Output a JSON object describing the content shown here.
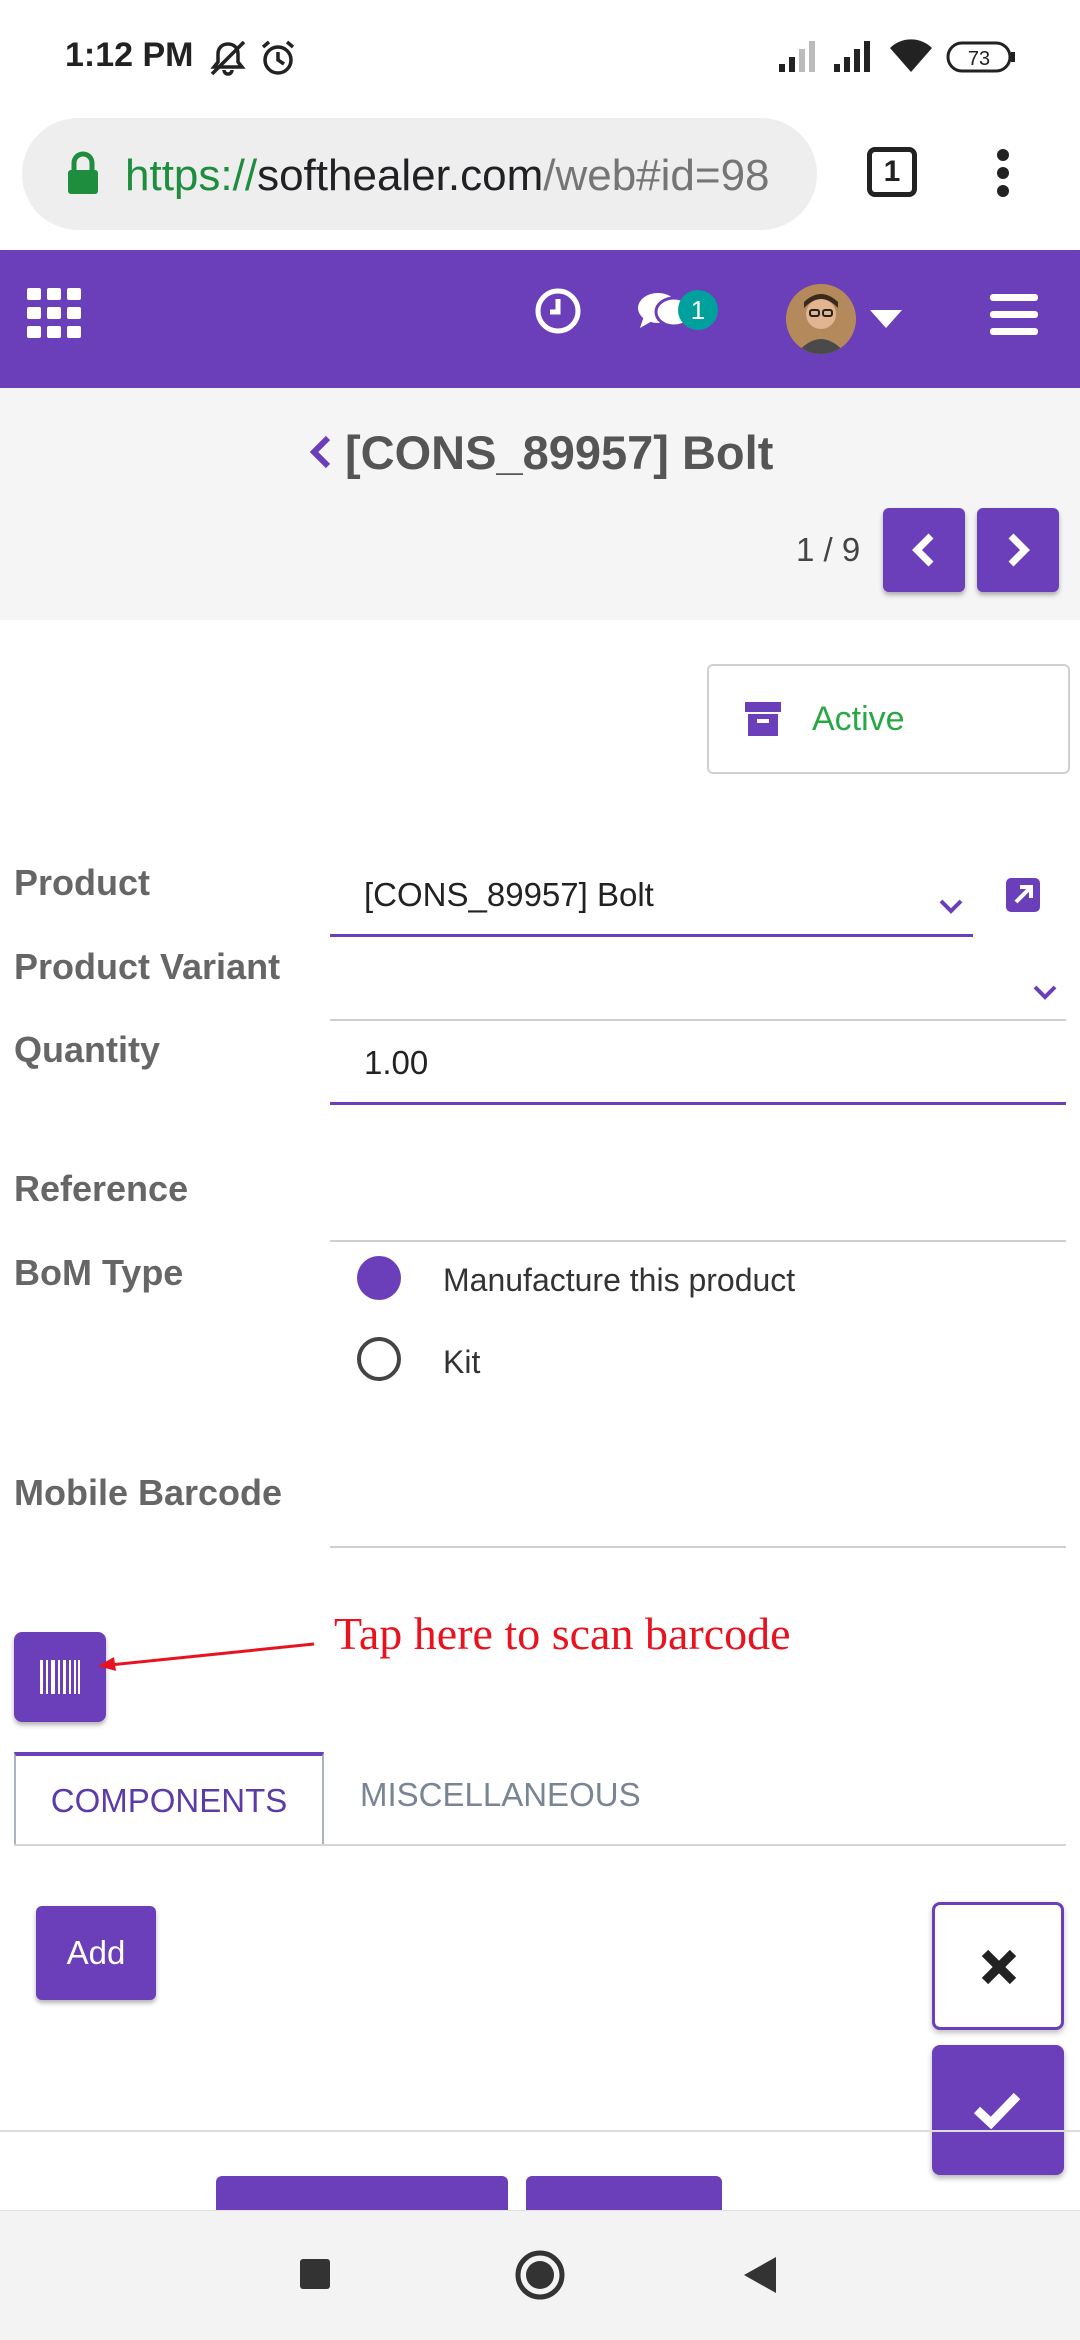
{
  "status_bar": {
    "time": "1:12 PM",
    "battery": "73"
  },
  "browser": {
    "url_scheme": "https://",
    "url_host": "softhealer.com",
    "url_path": "/web#id=98",
    "tab_count": "1"
  },
  "app_header": {
    "chat_badge": "1"
  },
  "breadcrumb": {
    "title": "[CONS_89957] Bolt",
    "pager": "1 / 9"
  },
  "status_button": {
    "label": "Active"
  },
  "form": {
    "product_label": "Product",
    "product_value": "[CONS_89957] Bolt",
    "variant_label": "Product Variant",
    "variant_value": "",
    "quantity_label": "Quantity",
    "quantity_value": "1.00",
    "reference_label": "Reference",
    "reference_value": "",
    "bom_type_label": "BoM Type",
    "bom_options": [
      "Manufacture this product",
      "Kit"
    ],
    "bom_selected": "Manufacture this product",
    "mobile_barcode_label": "Mobile Barcode",
    "mobile_barcode_value": ""
  },
  "annotation": {
    "text": "Tap here to scan barcode",
    "color": "#e8131f"
  },
  "tabs": [
    {
      "label": "COMPONENTS",
      "active": true
    },
    {
      "label": "MISCELLANEOUS",
      "active": false
    }
  ],
  "add_button": {
    "label": "Add"
  },
  "theme": {
    "primary": "#6b3fb9",
    "success": "#28a745"
  }
}
